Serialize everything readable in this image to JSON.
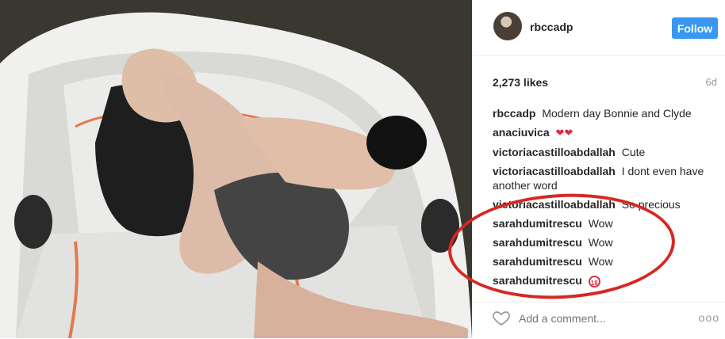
{
  "post": {
    "username": "rbccadp",
    "follow_label": "Follow",
    "likes": "2,273 likes",
    "age": "6d",
    "add_comment_placeholder": "Add a comment...",
    "more_label": "ooo",
    "comments": [
      {
        "user": "rbccadp",
        "text": "Modern day Bonnie and Clyde"
      },
      {
        "user": "anaciuvica",
        "text": "❤❤"
      },
      {
        "user": "victoriacastilloabdallah",
        "text": "Cute"
      },
      {
        "user": "victoriacastilloabdallah",
        "text": "I dont even have another word"
      },
      {
        "user": "victoriacastilloabdallah",
        "text": "So precious"
      },
      {
        "user": "sarahdumitrescu",
        "text": "Wow"
      },
      {
        "user": "sarahdumitrescu",
        "text": "Wow"
      },
      {
        "user": "sarahdumitrescu",
        "text": "Wow"
      },
      {
        "user": "sarahdumitrescu",
        "text": "18"
      }
    ]
  },
  "colors": {
    "follow_blue": "#3897f0",
    "annotation_red": "#d62822"
  }
}
